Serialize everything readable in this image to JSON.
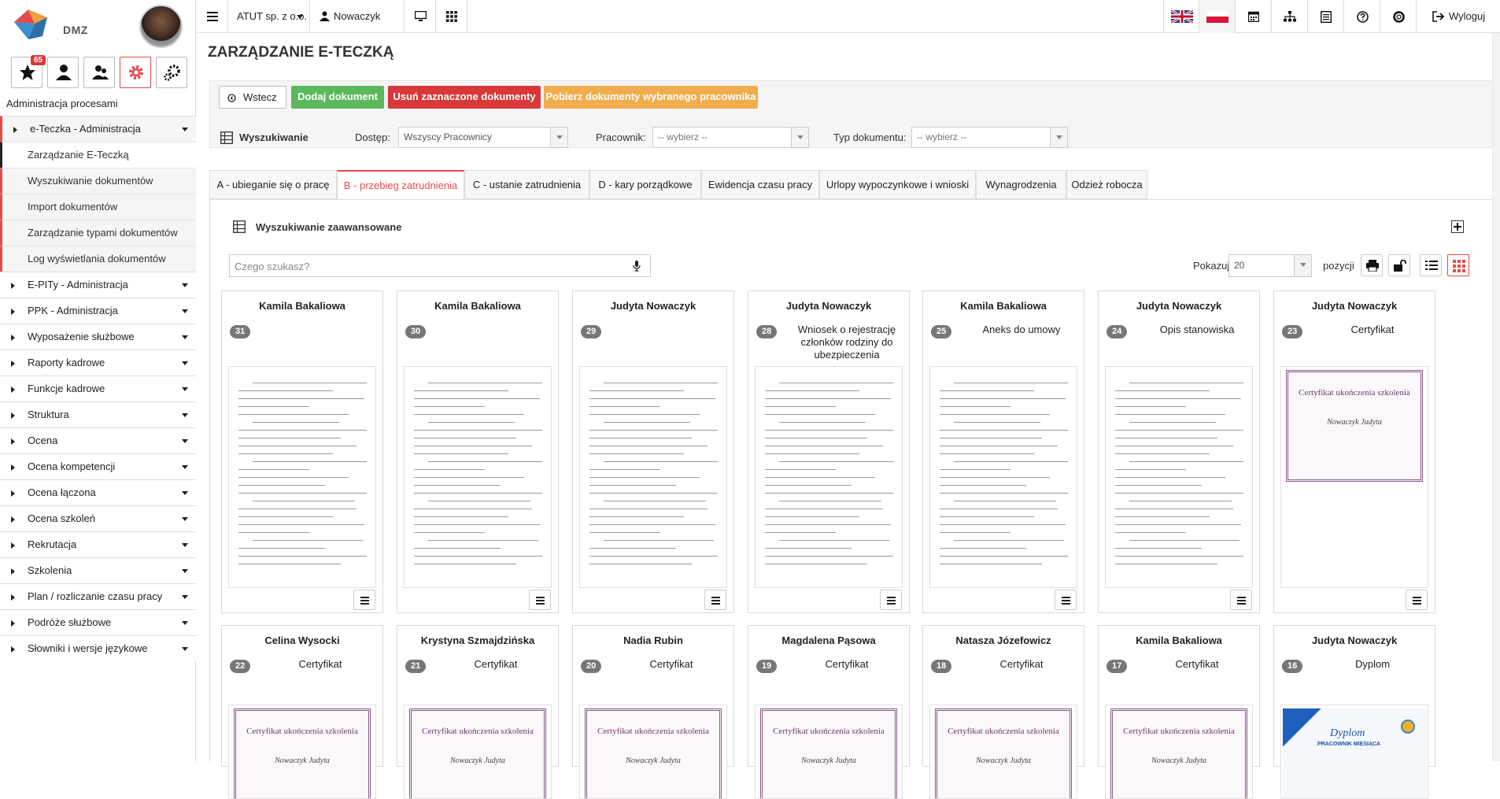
{
  "app": {
    "logo_text": "DMZ",
    "notification_count": "65"
  },
  "sidebar": {
    "process_title": "Administracja procesami",
    "open_item": "e-Teczka - Administracja",
    "subitems": [
      "Zarządzanie E-Teczką",
      "Wyszukiwanie dokumentów",
      "Import dokumentów",
      "Zarządzanie typami dokumentów",
      "Log wyświetlania dokumentów"
    ],
    "items": [
      "E-PITy - Administracja",
      "PPK - Administracja",
      "Wyposażenie służbowe",
      "Raporty kadrowe",
      "Funkcje kadrowe",
      "Struktura",
      "Ocena",
      "Ocena kompetencji",
      "Ocena łączona",
      "Ocena szkoleń",
      "Rekrutacja",
      "Szkolenia",
      "Plan / rozliczanie czasu pracy",
      "Podróże służbowe",
      "Słowniki i wersje językowe"
    ]
  },
  "topbar": {
    "company": "ATUT sp. z o.o.",
    "user": "Nowaczyk Judyta",
    "logout": "Wyloguj"
  },
  "page": {
    "title": "ZARZĄDZANIE E-TECZKĄ"
  },
  "actions": {
    "back": "Wstecz",
    "add": "Dodaj dokument",
    "delete": "Usuń zaznaczone dokumenty",
    "download": "Pobierz dokumenty wybranego pracownika"
  },
  "colors": {
    "accent": "#e34b4b",
    "add": "#5cb85c",
    "delete": "#d9383a",
    "download": "#f0ad4e"
  },
  "search": {
    "label": "Wyszukiwanie",
    "access_label": "Dostęp:",
    "access_value": "Wszyscy Pracownicy",
    "employee_label": "Pracownik:",
    "employee_value": "-- wybierz --",
    "doctype_label": "Typ dokumentu:",
    "doctype_value": "-- wybierz --"
  },
  "tabs": [
    "A - ubieganie się o pracę",
    "B - przebieg zatrudnienia",
    "C - ustanie zatrudnienia",
    "D - kary porządkowe",
    "Ewidencja czasu pracy",
    "Urlopy wypoczynkowe i wnioski",
    "Wynagrodzenia",
    "Odzież robocza"
  ],
  "advanced": {
    "title": "Wyszukiwanie zaawansowane",
    "search_placeholder": "Czego szukasz?",
    "show_label": "Pokazuj",
    "show_value": "20",
    "positions_label": "pozycji"
  },
  "cards": [
    {
      "name": "Kamila Bakaliowa",
      "num": "31",
      "doc": ""
    },
    {
      "name": "Kamila Bakaliowa",
      "num": "30",
      "doc": ""
    },
    {
      "name": "Judyta Nowaczyk",
      "num": "29",
      "doc": ""
    },
    {
      "name": "Judyta Nowaczyk",
      "num": "28",
      "doc": "Wniosek o rejestrację członków rodziny do ubezpieczenia"
    },
    {
      "name": "Kamila Bakaliowa",
      "num": "25",
      "doc": "Aneks do umowy"
    },
    {
      "name": "Judyta Nowaczyk",
      "num": "24",
      "doc": "Opis stanowiska"
    },
    {
      "name": "Judyta Nowaczyk",
      "num": "23",
      "doc": "Certyfikat"
    },
    {
      "name": "Celina Wysocki",
      "num": "22",
      "doc": "Certyfikat"
    },
    {
      "name": "Krystyna Szmajdzińska",
      "num": "21",
      "doc": "Certyfikat"
    },
    {
      "name": "Nadia Rubin",
      "num": "20",
      "doc": "Certyfikat"
    },
    {
      "name": "Magdalena Pąsowa",
      "num": "19",
      "doc": "Certyfikat"
    },
    {
      "name": "Natasza Józefowicz",
      "num": "18",
      "doc": "Certyfikat"
    },
    {
      "name": "Kamila Bakaliowa",
      "num": "17",
      "doc": "Certyfikat"
    },
    {
      "name": "Judyta Nowaczyk",
      "num": "16",
      "doc": "Dyplom"
    }
  ],
  "certificate": {
    "title": "Certyfikat ukończenia szkolenia",
    "name": "Nowaczyk Judyta"
  },
  "diploma": {
    "title": "Dyplom",
    "subtitle": "PRACOWNIK MIESIĄCA"
  }
}
